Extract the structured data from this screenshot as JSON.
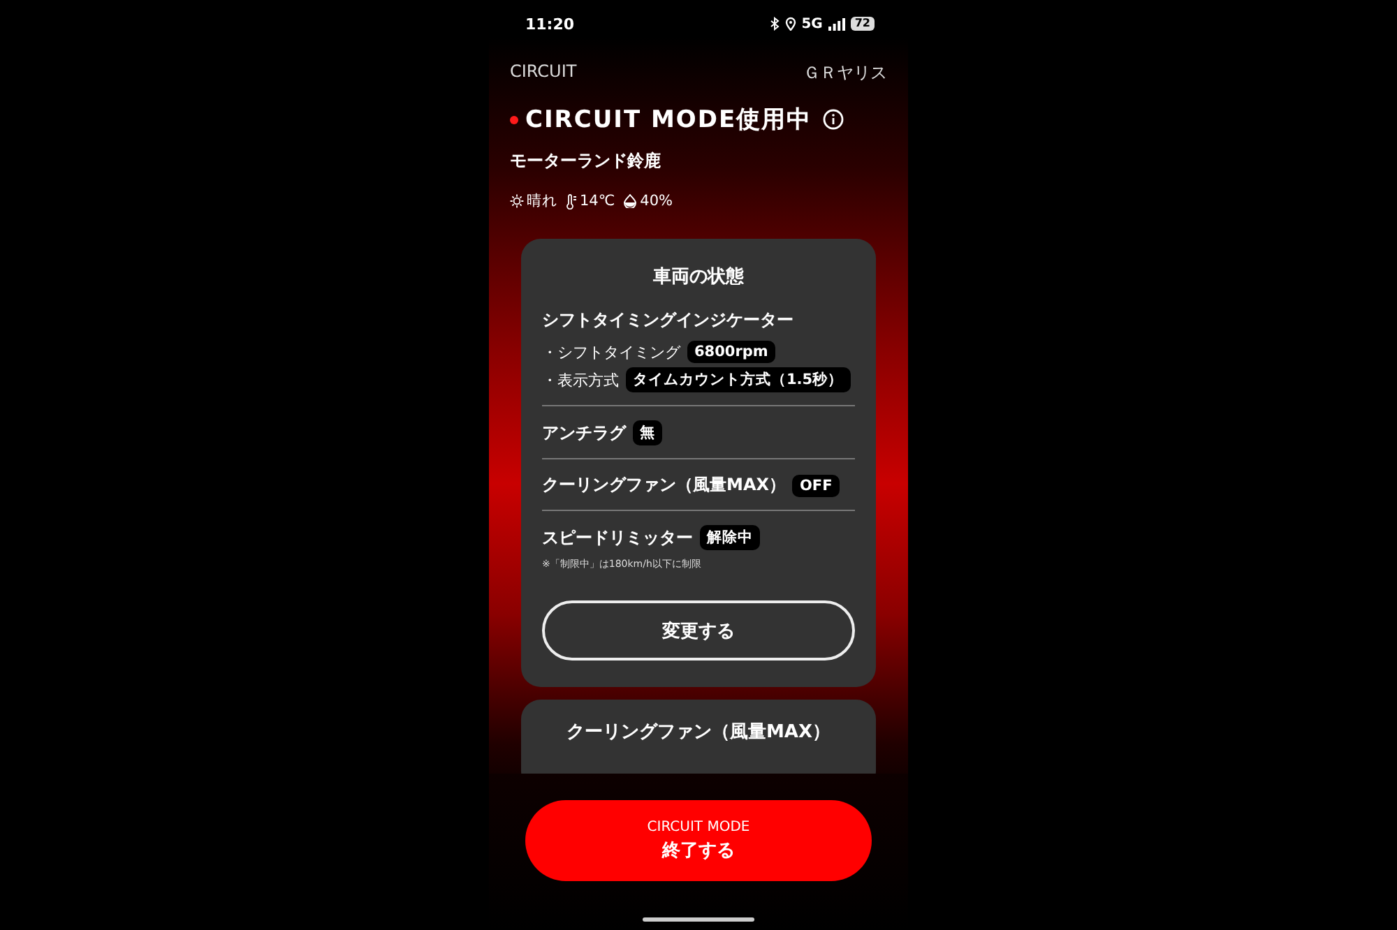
{
  "status_bar": {
    "time": "11:20",
    "network": "5G",
    "battery": "72"
  },
  "header": {
    "left": "CIRCUIT",
    "right": "ＧＲヤリス"
  },
  "mode": {
    "title": "CIRCUIT MODE使用中",
    "active": true
  },
  "location": "モーターランド鈴鹿",
  "weather": {
    "condition": "晴れ",
    "temperature": "14℃",
    "humidity": "40%"
  },
  "card": {
    "title": "車両の状態",
    "sections": [
      {
        "kind": "group",
        "title": "シフトタイミングインジケーター",
        "settings": [
          {
            "label": "・シフトタイミング",
            "value": "6800rpm"
          },
          {
            "label": "・表示方式",
            "value": "タイムカウント方式（1.5秒）"
          }
        ]
      },
      {
        "kind": "setting",
        "label": "アンチラグ",
        "value": "無"
      },
      {
        "kind": "setting",
        "label": "クーリングファン（風量MAX）",
        "value": "OFF"
      },
      {
        "kind": "setting",
        "label": "スピードリミッター",
        "value": "解除中",
        "note": "※「制限中」は180km/h以下に制限"
      }
    ],
    "button": "変更する"
  },
  "next_card": {
    "title": "クーリングファン（風量MAX）"
  },
  "end_button": {
    "caption": "CIRCUIT MODE",
    "label": "終了する"
  }
}
